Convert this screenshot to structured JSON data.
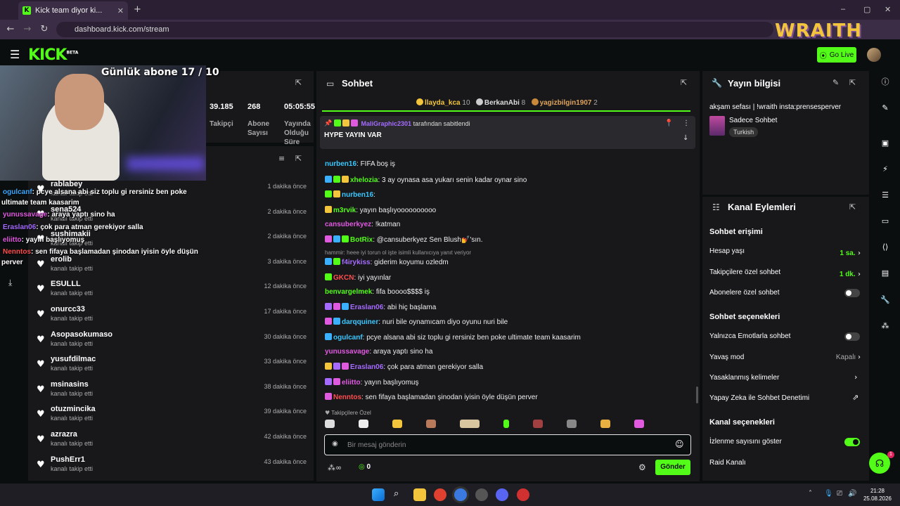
{
  "browser": {
    "tab_title": "Kick team diyor ki...",
    "url": "dashboard.kick.com/stream",
    "window_controls": [
      "–",
      "▢",
      "✕"
    ]
  },
  "overlay": {
    "wraith_logo": "WRAITH",
    "sub_goal": "Günlük abone 17 / 10"
  },
  "header": {
    "logo": "KICK",
    "logo_tag": "BETA",
    "go_live_label": "Go Live"
  },
  "stats": {
    "items": [
      {
        "value": "39.185",
        "label": "Takipçi"
      },
      {
        "value": "268",
        "label": "Abone Sayısı"
      },
      {
        "value": "05:05:55",
        "label": "Yayında Olduğu Süre"
      }
    ]
  },
  "followers": [
    {
      "name": "rablabey",
      "sub": "kanalı takip etti",
      "time": "1 dakika önce"
    },
    {
      "name": "sena524",
      "sub": "kanalı takip etti",
      "time": "2 dakika önce"
    },
    {
      "name": "sushimakii",
      "sub": "kanalı takip etti",
      "time": "2 dakika önce"
    },
    {
      "name": "erolib",
      "sub": "kanalı takip etti",
      "time": "3 dakika önce"
    },
    {
      "name": "ESULLL",
      "sub": "kanalı takip etti",
      "time": "12 dakika önce"
    },
    {
      "name": "onurcc33",
      "sub": "kanalı takip etti",
      "time": "17 dakika önce"
    },
    {
      "name": "Asopasokumaso",
      "sub": "kanalı takip etti",
      "time": "30 dakika önce"
    },
    {
      "name": "yusufdilmac",
      "sub": "kanalı takip etti",
      "time": "33 dakika önce"
    },
    {
      "name": "msinasins",
      "sub": "kanalı takip etti",
      "time": "38 dakika önce"
    },
    {
      "name": "otuzmincika",
      "sub": "kanalı takip etti",
      "time": "39 dakika önce"
    },
    {
      "name": "azrazra",
      "sub": "kanalı takip etti",
      "time": "42 dakika önce"
    },
    {
      "name": "PushErr1",
      "sub": "kanalı takip etti",
      "time": "43 dakika önce"
    }
  ],
  "overlay_chat": [
    {
      "user": "ogulcanf",
      "text": ": pcye alsana abi siz toplu gi rersiniz ben poke",
      "color": "#3ba8ff"
    },
    {
      "user": "",
      "text": "ultimate team kaasarim",
      "color": "#ffffff"
    },
    {
      "user": "yunussavage",
      "text": ": araya yaptı sino ha",
      "color": "#e05ae0"
    },
    {
      "user": "Eraslan06",
      "text": ": çok para atman gerekiyor salla",
      "color": "#a56bff"
    },
    {
      "user": "eliitto",
      "text": ": yayın başlıyomuş",
      "color": "#e05ae0"
    },
    {
      "user": "Nenntos",
      "text": ": sen fifaya başlamadan şinodan iyisin öyle düşün",
      "color": "#ff4d4d"
    },
    {
      "user": "",
      "text": "perver",
      "color": "#ffffff"
    }
  ],
  "chat": {
    "title": "Sohbet",
    "top_gifters": [
      {
        "name": "llayda_kca",
        "count": "10"
      },
      {
        "name": "BerkanAbi",
        "count": "8"
      },
      {
        "name": "yagizbilgin1907",
        "count": "2"
      }
    ],
    "pinned_by_user": "MaliGraphic2301",
    "pinned_by_text": "tarafından sabitlendi",
    "pinned_message": "HYPE YAYIN VAR",
    "messages": [
      {
        "user": "nurben16",
        "text": ": FIFA boş iş",
        "color": "#3ac8ff"
      },
      {
        "user": "xhelozia",
        "text": ": 3 ay oynasa asa yukarı senin kadar oynar sino",
        "color": "#53fc18"
      },
      {
        "user": "nurben16",
        "text": ":",
        "color": "#3ac8ff"
      },
      {
        "user": "m3rvik",
        "text": ": yayın başlıyoooooooooo",
        "color": "#53fc18"
      },
      {
        "user": "cansuberkyez",
        "text": ": !katman",
        "color": "#e05ae0"
      },
      {
        "user": "BotRix",
        "text": ": @cansuberkyez Sen Blush💅'sın.",
        "color": "#53fc18"
      },
      {
        "user": "f4irykiss",
        "text": ": giderim koyumu ozledm",
        "color": "#a56bff"
      },
      {
        "user": "GKCN",
        "text": ": iyi yayınlar",
        "color": "#ff4d4d"
      },
      {
        "user": "benvargelmek",
        "text": ": fifa boooo$$$$ iş",
        "color": "#53fc18"
      },
      {
        "user": "Eraslan06",
        "text": ": abi hiç başlama",
        "color": "#a56bff"
      },
      {
        "user": "darqquiner",
        "text": ": nuri bile oynamıcam diyo oyunu nuri bile",
        "color": "#3ac8ff"
      },
      {
        "user": "ogulcanf",
        "text": ": pcye alsana abi siz toplu gi rersiniz ben poke ultimate team kaasarim",
        "color": "#3ac8ff"
      },
      {
        "user": "yunussavage",
        "text": ": araya yaptı sino ha",
        "color": "#e05ae0"
      },
      {
        "user": "Eraslan06",
        "text": ": çok para atman gerekiyor salla",
        "color": "#a56bff"
      },
      {
        "user": "eliitto",
        "text": ": yayın başlıyomuş",
        "color": "#e05ae0"
      },
      {
        "user": "Nenntos",
        "text": ": sen fifaya başlamadan şinodan iyisin öyle düşün perver",
        "color": "#ff4d4d"
      }
    ],
    "reply_hint": "hammir: heee iyi torun ol işte isimli kullanıcıya yanıt veriyor",
    "followers_only_label": "Takipçilere Özel",
    "input_placeholder": "Bir mesaj gönderin",
    "points_value": "0",
    "send_label": "Gönder"
  },
  "stream_info": {
    "title": "Yayın bilgisi",
    "stream_title": "akşam sefası | !wraith insta:prensesperver",
    "category": "Sadece Sohbet",
    "tag": "Turkish"
  },
  "channel_actions": {
    "title": "Kanal Eylemleri",
    "chat_access_title": "Sohbet erişimi",
    "account_age_label": "Hesap yaşı",
    "account_age_value": "1 sa.",
    "followers_only_label": "Takipçilere özel sohbet",
    "followers_only_value": "1 dk.",
    "subs_only_label": "Abonelere özel sohbet",
    "chat_options_title": "Sohbet seçenekleri",
    "emote_only_label": "Yalnızca Emotlarla sohbet",
    "slow_mode_label": "Yavaş mod",
    "slow_mode_value": "Kapalı",
    "banned_words_label": "Yasaklanmış kelimeler",
    "ai_moderation_label": "Yapay Zeka ile Sohbet Denetimi",
    "channel_options_title": "Kanal seçenekleri",
    "show_viewers_label": "İzlenme sayısını göster",
    "raid_label": "Raid Kanalı"
  },
  "taskbar": {
    "time": "21:28",
    "date": "25.08.2026"
  },
  "colors": {
    "brand": "#53fc18",
    "panel": "#18181b",
    "background": "#0b0e0f"
  }
}
